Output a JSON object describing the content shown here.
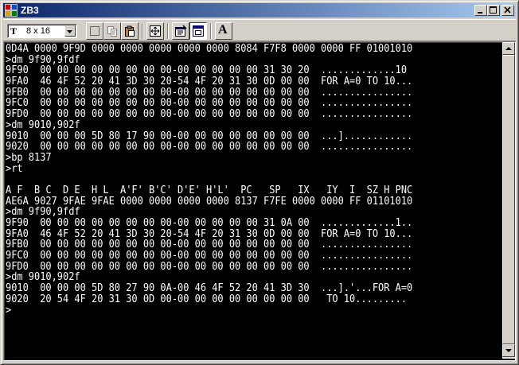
{
  "window": {
    "title": "ZB3"
  },
  "toolbar": {
    "font_size_value": "8 x 16",
    "font_glyph": "T",
    "bold_glyph": "A"
  },
  "icons": {
    "app": "app-icon",
    "minimize": "minimize-icon",
    "maximize": "maximize-icon",
    "close": "close-icon",
    "select": "select-icon",
    "copy": "copy-icon",
    "paste": "paste-icon",
    "fit": "fit-icon",
    "properties": "properties-icon",
    "window": "window-icon",
    "bold": "bold-icon"
  },
  "colors": {
    "title_start": "#0a246a",
    "title_end": "#a6caf0",
    "console_bg": "#000000",
    "console_fg": "#ffffff"
  },
  "console": {
    "lines": [
      "0D4A 0000 9F9D 0000 0000 0000 0000 0000 8084 F7F8 0000 0000 FF 01001010",
      ">dm 9f90,9fdf",
      "9F90  00 00 00 00 00 00 00 00-00 00 00 00 00 31 30 20  .............10 ",
      "9FA0  46 4F 52 20 41 3D 30 20-54 4F 20 31 30 0D 00 00  FOR A=0 TO 10...",
      "9FB0  00 00 00 00 00 00 00 00-00 00 00 00 00 00 00 00  ................",
      "9FC0  00 00 00 00 00 00 00 00-00 00 00 00 00 00 00 00  ................",
      "9FD0  00 00 00 00 00 00 00 00-00 00 00 00 00 00 00 00  ................",
      ">dm 9010,902f",
      "9010  00 00 00 5D 80 17 90 00-00 00 00 00 00 00 00 00  ...]............",
      "9020  00 00 00 00 00 00 00 00-00 00 00 00 00 00 00 00  ................",
      ">bp 8137",
      ">rt",
      "",
      "A F  B C  D E  H L  A'F' B'C' D'E' H'L'  PC   SP   IX   IY  I  SZ H PNC",
      "AE6A 9027 9FAE 9FAE 0000 0000 0000 0000 8137 F7FE 0000 0000 FF 01101010",
      ">dm 9f90,9fdf",
      "9F90  00 00 00 00 00 00 00 00-00 00 00 00 00 31 0A 00  .............1..",
      "9FA0  46 4F 52 20 41 3D 30 20-54 4F 20 31 30 0D 00 00  FOR A=0 TO 10...",
      "9FB0  00 00 00 00 00 00 00 00-00 00 00 00 00 00 00 00  ................",
      "9FC0  00 00 00 00 00 00 00 00-00 00 00 00 00 00 00 00  ................",
      "9FD0  00 00 00 00 00 00 00 00-00 00 00 00 00 00 00 00  ................",
      ">dm 9010,902f",
      "9010  00 00 00 5D 80 27 90 0A-00 46 4F 52 20 41 3D 30  ...].'...FOR A=0",
      "9020  20 54 4F 20 31 30 0D 00-00 00 00 00 00 00 00 00   TO 10.........",
      ">"
    ]
  }
}
